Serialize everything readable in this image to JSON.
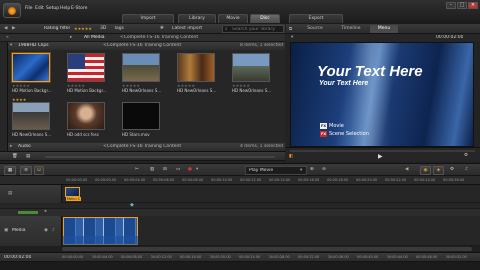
{
  "app": {
    "menu": [
      "File",
      "Edit",
      "Setup",
      "Help",
      "E-Store"
    ],
    "mode_tabs": [
      "Import",
      "Library",
      "Movie",
      "Disc",
      "Export"
    ],
    "active_mode": "Disc"
  },
  "library": {
    "rating_filter_label": "Rating filter",
    "nav_label": "All Media",
    "path": "<Complete FS-16 Training Content",
    "tags_label": "Tags",
    "recent_label": "Latest import",
    "search_placeholder": "Search your library",
    "video_section": {
      "title": "1988HD Clips",
      "path": "<Complete FS-16 Training Content",
      "count": "8 items, 1 selected",
      "clips": [
        {
          "name": "HD Motion Backgr...",
          "kind": "blue"
        },
        {
          "name": "HD Motion Backgr...",
          "kind": "flag"
        },
        {
          "name": "HD NewOrleans S...",
          "kind": "street"
        },
        {
          "name": "HD NewOrleans S...",
          "kind": "band"
        },
        {
          "name": "HD NewOrleans S...",
          "kind": "city"
        },
        {
          "name": "HD NewOrleans S...",
          "kind": "market"
        },
        {
          "name": "HD odd scs fess",
          "kind": "face"
        },
        {
          "name": "HD Stars.mov",
          "kind": "dark"
        }
      ]
    },
    "audio_section": {
      "title": "Audio",
      "path": "<Complete FS-16 Training Content",
      "count": "4 items, 1 selected"
    }
  },
  "preview": {
    "tabs": [
      "Source",
      "Timeline",
      "Menu"
    ],
    "active_tab": "Menu",
    "timecode": "00:00:02:00",
    "title_text": "Your Text Here",
    "subtitle_text": "Your Text Here",
    "menu_items": [
      "Movie",
      "Scene Selection"
    ],
    "menu_bullets": [
      "FX",
      "FX"
    ],
    "bottom_timecode": "00:00:02:00"
  },
  "timeline": {
    "play_label": "Play Movie",
    "timecode": "00:00:02:00",
    "ruler_marks": [
      "00:00:00.00",
      "00:00:00.00",
      "00:00:04.00",
      "00:00:06.00",
      "00:00:08.00",
      "00:00:10.00",
      "00:00:12.00",
      "00:00:14.00",
      "00:00:16.00",
      "00:00:18.00",
      "00:00:20.00",
      "00:00:22.00",
      "00:00:24.00",
      "00:00:26.00"
    ],
    "menu_track_label": "Menu 1",
    "media_track_label": "Media",
    "footer_timecode": "00:00:02:00",
    "footer_marks": [
      "00:00:00.00",
      "00:00:04.00",
      "00:00:08.00",
      "00:00:12.00",
      "00:00:16.00",
      "00:00:20.00",
      "00:00:24.00",
      "00:00:28.00",
      "00:00:32.00",
      "00:00:36.00",
      "00:00:40.00",
      "00:00:44.00",
      "00:00:48.00",
      "00:00:52.00"
    ]
  },
  "colors": {
    "accent": "#f0a020",
    "preview_bg": "#1c3e7a"
  }
}
